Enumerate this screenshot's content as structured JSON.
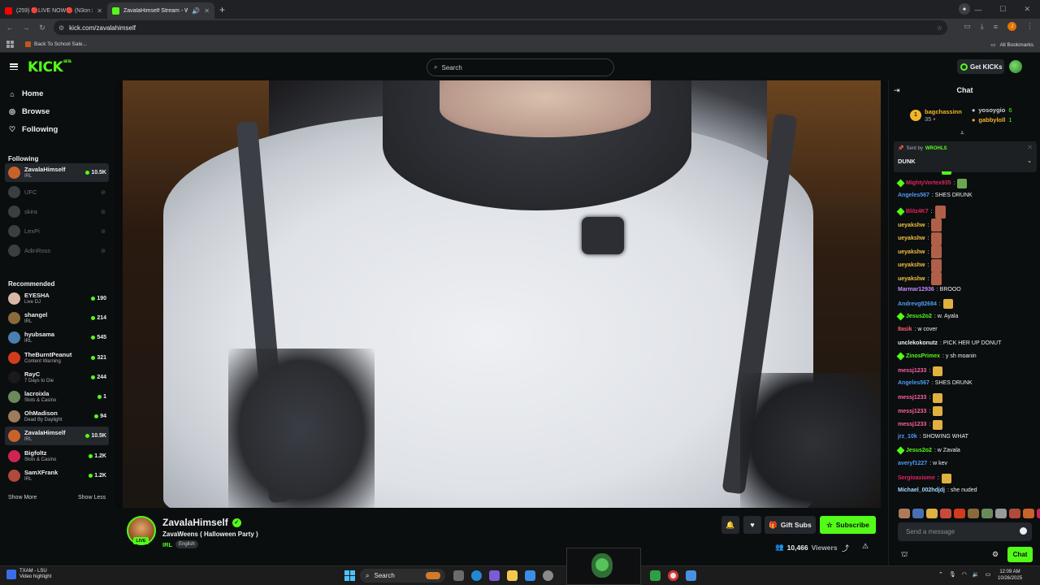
{
  "browser": {
    "tabs": [
      {
        "title": "(259) 🔴LIVE NOW🔴 (N3on x",
        "favicon_color": "#ff0000",
        "active": false
      },
      {
        "title": "ZavalaHimself Stream - Wa",
        "favicon_color": "#53fc18",
        "active": true
      }
    ],
    "url": "kick.com/zavalahimself",
    "profile_initial": "J",
    "bookmarks": [
      {
        "label": "Back To School Sale..."
      }
    ],
    "all_bookmarks_label": "All Bookmarks"
  },
  "header": {
    "logo": "KICK",
    "logo_sup": "BETA",
    "search_placeholder": "Search",
    "get_kicks_label": "Get KICKs"
  },
  "sidebar": {
    "nav": [
      {
        "label": "Home",
        "icon": "home-icon"
      },
      {
        "label": "Browse",
        "icon": "compass-icon"
      },
      {
        "label": "Following",
        "icon": "heart-icon"
      }
    ],
    "following_heading": "Following",
    "following": [
      {
        "name": "ZavalaHimself",
        "category": "IRL",
        "viewers": "10.5K",
        "live": true,
        "selected": true,
        "color": "#c8622b"
      },
      {
        "name": "UFC",
        "category": "",
        "viewers": "",
        "live": false,
        "color": "#3b3f42"
      },
      {
        "name": "skira",
        "category": "",
        "viewers": "",
        "live": false,
        "color": "#3b3f42"
      },
      {
        "name": "LexPi",
        "category": "",
        "viewers": "",
        "live": false,
        "color": "#3b3f42"
      },
      {
        "name": "AdinRoss",
        "category": "",
        "viewers": "",
        "live": false,
        "color": "#3b3f42"
      }
    ],
    "recommended_heading": "Recommended",
    "recommended": [
      {
        "name": "EYESHA",
        "category": "Live DJ",
        "viewers": "190",
        "color": "#d9b8a8"
      },
      {
        "name": "shangel",
        "category": "IRL",
        "viewers": "214",
        "color": "#8a6a3c"
      },
      {
        "name": "hyubsama",
        "category": "IRL",
        "viewers": "545",
        "color": "#4a7fb0"
      },
      {
        "name": "TheBurntPeanut",
        "category": "Content Warning",
        "viewers": "321",
        "color": "#d23c1c"
      },
      {
        "name": "RayC",
        "category": "7 Days to Die",
        "viewers": "244",
        "color": "#1a1a1a"
      },
      {
        "name": "lacroixla",
        "category": "Slots & Casino",
        "viewers": "1",
        "color": "#6b8a5a"
      },
      {
        "name": "OhMadison",
        "category": "Dead By Daylight",
        "viewers": "94",
        "color": "#9c7b5f"
      },
      {
        "name": "ZavalaHimself",
        "category": "IRL",
        "viewers": "10.5K",
        "selected": true,
        "color": "#c8622b"
      },
      {
        "name": "Bigfoltz",
        "category": "Slots & Casino",
        "viewers": "1.2K",
        "color": "#d02452"
      },
      {
        "name": "SamXFrank",
        "category": "IRL",
        "viewers": "1.2K",
        "color": "#b04a3a"
      }
    ],
    "show_more": "Show More",
    "show_less": "Show Less"
  },
  "stream": {
    "channel": "ZavalaHimself",
    "live_badge": "LIVE",
    "title": "ZavaWeens ( Halloween Party )",
    "category": "IRL",
    "language": "English",
    "gift_subs_label": "Gift Subs",
    "subscribe_label": "Subscribe",
    "viewers": "10,466",
    "viewers_label": "Viewers"
  },
  "chat": {
    "title": "Chat",
    "leaderboard": [
      {
        "rank": "1",
        "name": "bagchassinn",
        "count": "35",
        "color": "#f0b62a"
      },
      {
        "name": "yosoygio",
        "count": "6",
        "color": "#cdd0d3"
      },
      {
        "name": "gabbyloll",
        "count": "1",
        "color": "#f0b62a"
      }
    ],
    "pinned": {
      "sent_by_label": "Sent by",
      "sender": "WROHLS",
      "message": "DUNK"
    },
    "messages": [
      {
        "user": "emmanuel123",
        "text": "",
        "color": "#adadb8",
        "emote": "#53fc18",
        "badge": false
      },
      {
        "user": "MightyVortex935",
        "text": "",
        "color": "#e0245e",
        "emote": "#6aa84f",
        "badge": true
      },
      {
        "user": "Angeles567",
        "text": ": SHES DRUNK",
        "color": "#4d9cf2",
        "emote": "",
        "badge": false
      },
      {
        "user": "Blitz4K7",
        "text": "",
        "color": "#e0245e",
        "emote": "#b06048",
        "badge": true,
        "big": true
      },
      {
        "user": "ueyakshw",
        "text": "",
        "color": "#f0c040",
        "emote": "#b06048",
        "badge": false,
        "big": true
      },
      {
        "user": "ueyakshw",
        "text": "",
        "color": "#f0c040",
        "emote": "#b06048",
        "badge": false,
        "big": true
      },
      {
        "user": "ueyakshw",
        "text": "",
        "color": "#f0c040",
        "emote": "#b06048",
        "badge": false,
        "big": true
      },
      {
        "user": "ueyakshw",
        "text": "",
        "color": "#f0c040",
        "emote": "#b06048",
        "badge": false,
        "big": true
      },
      {
        "user": "ueyakshw",
        "text": "",
        "color": "#f0c040",
        "emote": "#b06048",
        "badge": false,
        "big": true
      },
      {
        "user": "Marmar12936",
        "text": ": BROOO",
        "color": "#c58af9",
        "emote": "",
        "badge": false
      },
      {
        "user": "Andrevg82684",
        "text": "",
        "color": "#4d9cf2",
        "emote": "#e0b040",
        "badge": false
      },
      {
        "user": "Jesus2o2",
        "text": ": w. Ayala",
        "color": "#53fc18",
        "emote": "",
        "badge": true
      },
      {
        "user": "8asik",
        "text": ": w cover",
        "color": "#ff5f6d",
        "emote": "",
        "badge": false
      },
      {
        "user": "unclekokonutz",
        "text": ": PICK HER UP DONUT",
        "color": "#efeff1",
        "emote": "",
        "badge": false
      },
      {
        "user": "ZinosPrimex",
        "text": ": y sh moanin",
        "color": "#53fc18",
        "emote": "",
        "badge": true
      },
      {
        "user": "messj1233",
        "text": "",
        "color": "#ff5fa0",
        "emote": "#e0b040",
        "badge": false
      },
      {
        "user": "Angeles567",
        "text": ": SHES DRUNK",
        "color": "#4d9cf2",
        "emote": "",
        "badge": false
      },
      {
        "user": "messj1233",
        "text": "",
        "color": "#ff5fa0",
        "emote": "#e0b040",
        "badge": false
      },
      {
        "user": "messj1233",
        "text": "",
        "color": "#ff5fa0",
        "emote": "#e0b040",
        "badge": false
      },
      {
        "user": "messj1233",
        "text": "",
        "color": "#ff5fa0",
        "emote": "#e0b040",
        "badge": false
      },
      {
        "user": "jrz_10k",
        "text": ": SHOWING WHAT",
        "color": "#4d9cf2",
        "emote": "",
        "badge": false
      },
      {
        "user": "Jesus2o2",
        "text": ": w Zavala",
        "color": "#53fc18",
        "emote": "",
        "badge": true
      },
      {
        "user": "averyf1227",
        "text": ": w kev",
        "color": "#4d9cf2",
        "emote": "",
        "badge": false
      },
      {
        "user": "Sergioaxiome",
        "text": "",
        "color": "#e0245e",
        "emote": "#e0b040",
        "badge": false
      },
      {
        "user": "Michael_002hdjdj",
        "text": ": she nuded",
        "color": "#a6d8ff",
        "emote": "",
        "badge": false
      }
    ],
    "emote_colors": [
      "#b07a5a",
      "#4a6fb0",
      "#e0b040",
      "#c84a3a",
      "#d23c1c",
      "#8a6a3c",
      "#6b8a5a",
      "#999999",
      "#b04a3a",
      "#c8622b",
      "#d02452"
    ],
    "input_placeholder": "Send a message",
    "chat_button": "Chat"
  },
  "taskbar": {
    "weather_title": "TXAM - LSU",
    "weather_sub": "Video highlight",
    "search_label": "Search",
    "time": "12:09 AM",
    "date": "10/26/2025"
  }
}
